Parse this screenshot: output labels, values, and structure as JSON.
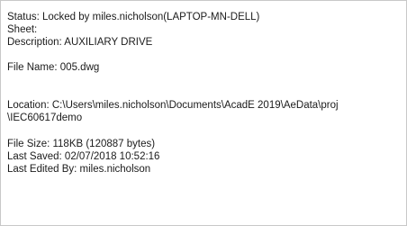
{
  "file_info": {
    "status": "Status: Locked by miles.nicholson(LAPTOP-MN-DELL)",
    "sheet": "Sheet:",
    "description": "Description: AUXILIARY DRIVE",
    "file_name": "File Name: 005.dwg",
    "location_line1": "Location: C:\\Users\\miles.nicholson\\Documents\\AcadE 2019\\AeData\\proj",
    "location_line2": "\\IEC60617demo",
    "file_size": "File Size: 118KB (120887 bytes)",
    "last_saved": "Last Saved: 02/07/2018 10:52:16",
    "last_edited_by": "Last Edited By: miles.nicholson"
  }
}
